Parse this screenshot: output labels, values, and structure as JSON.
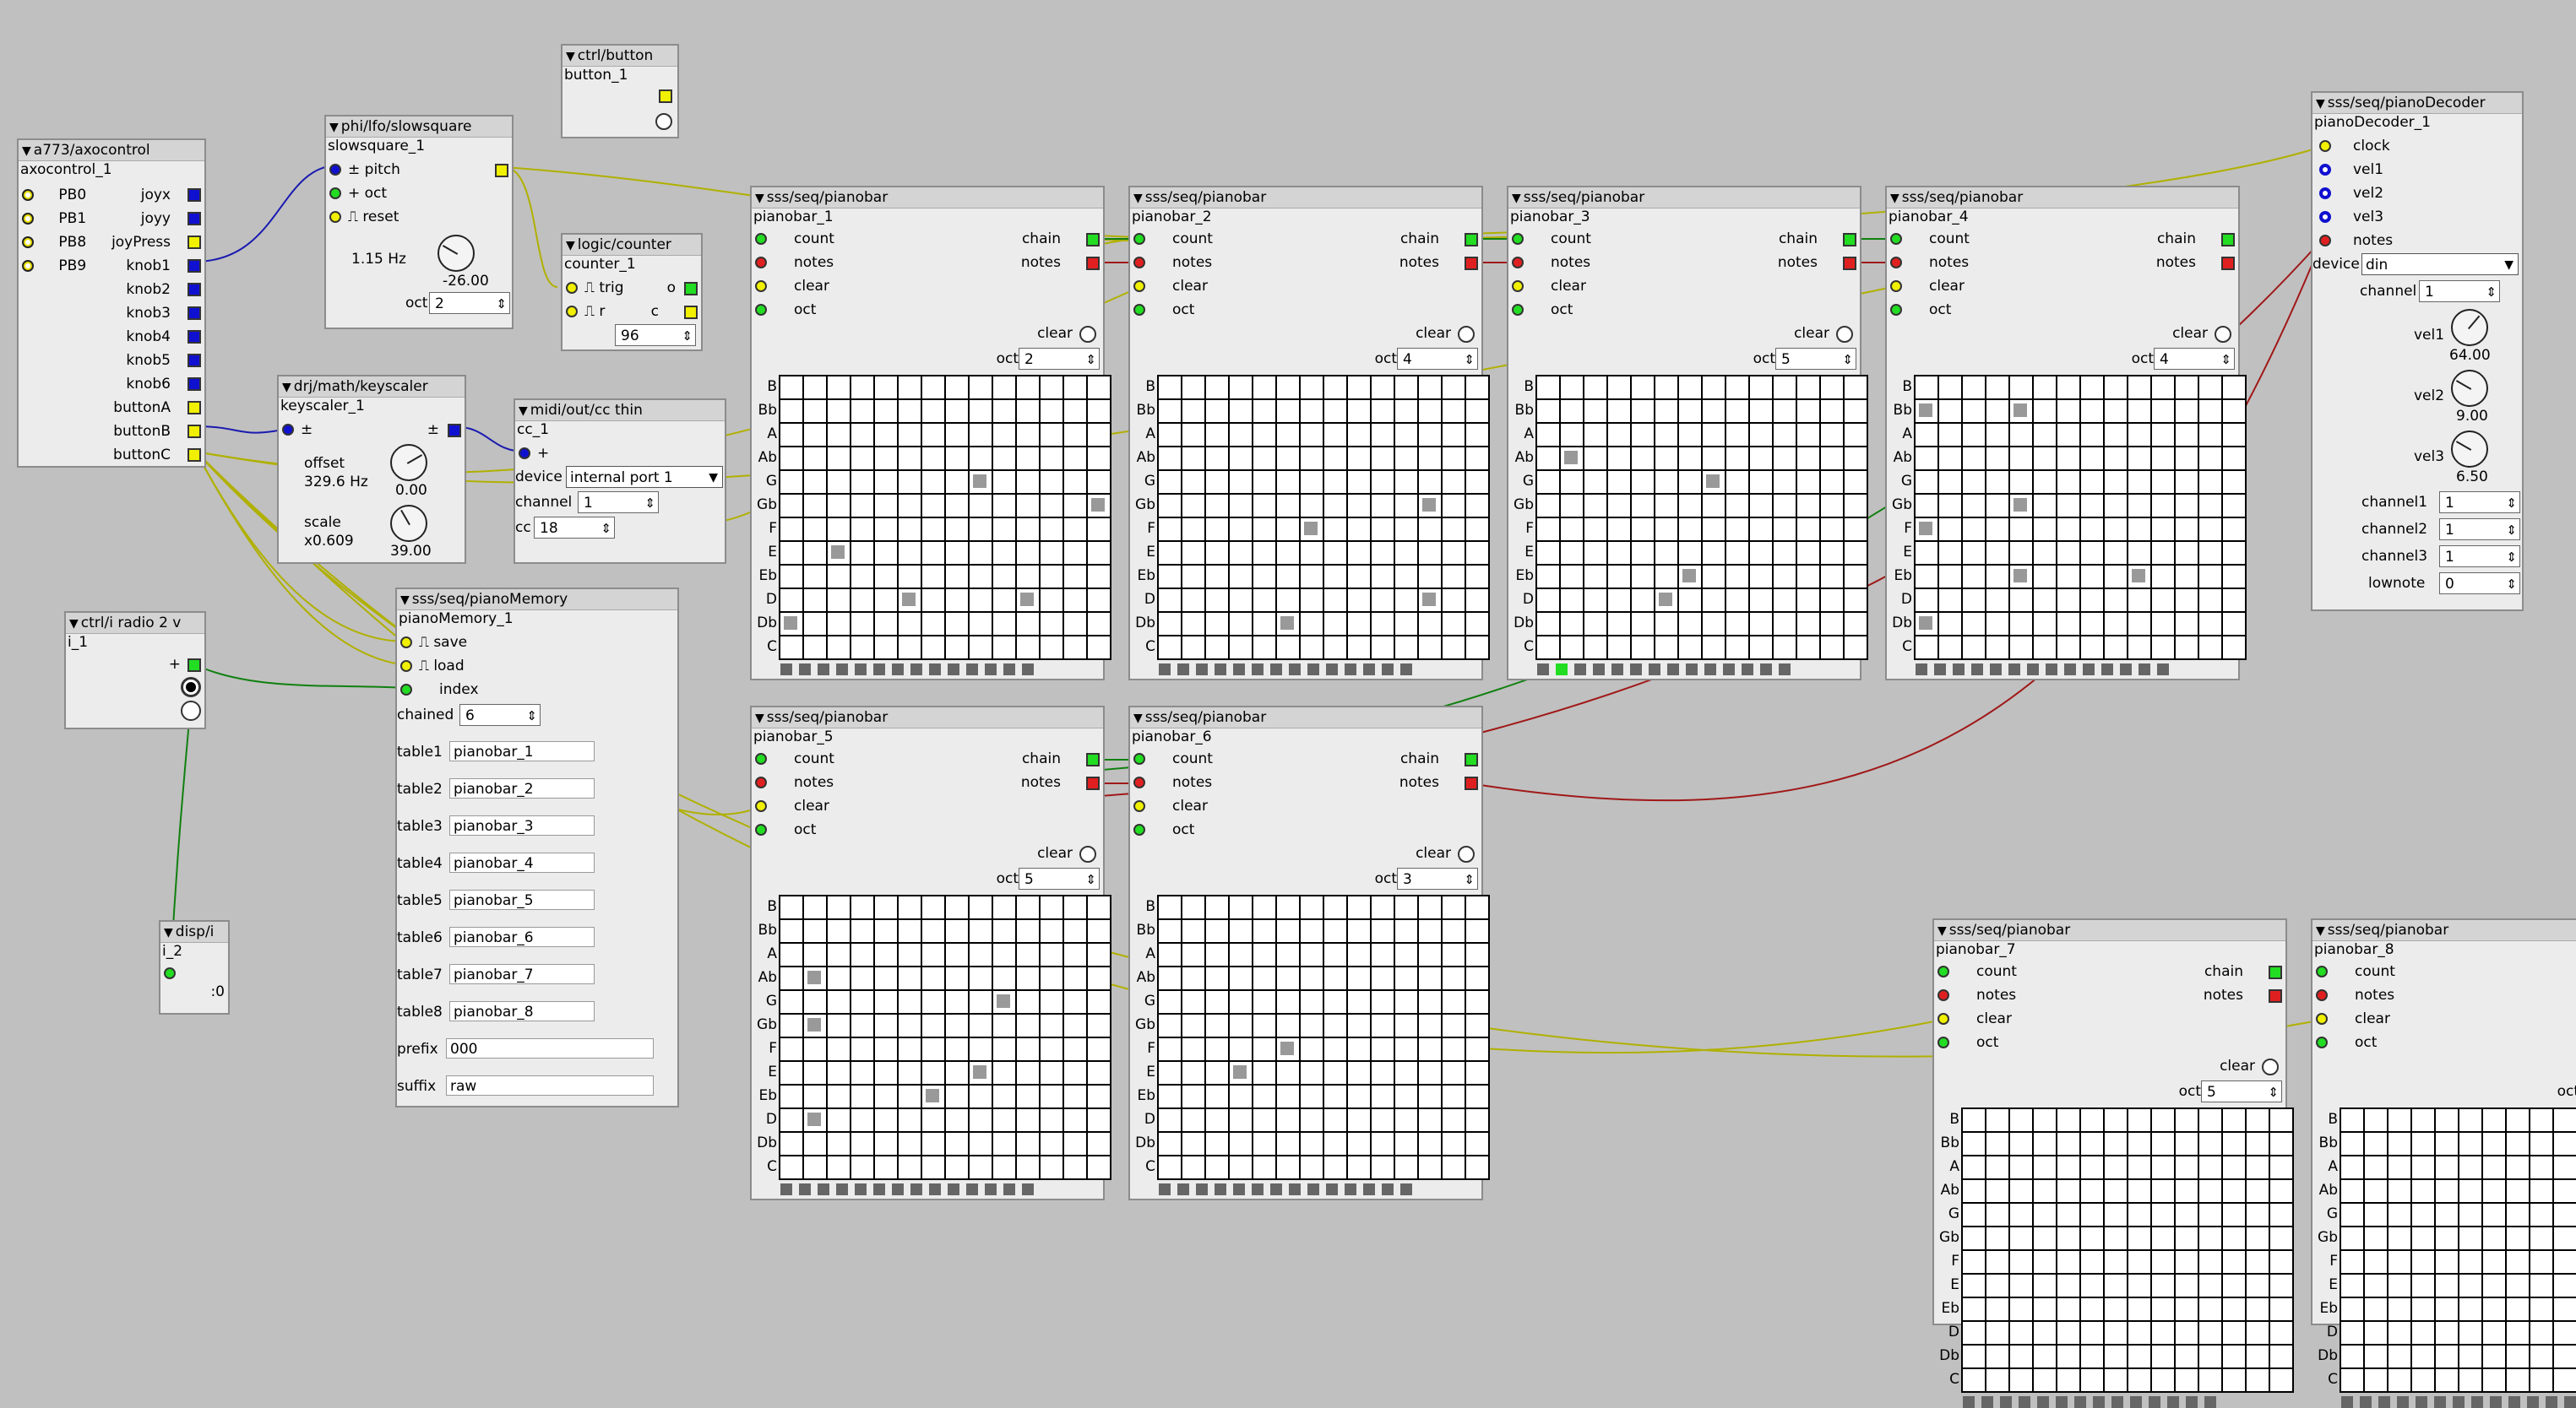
{
  "axocontrol": {
    "title": "a773/axocontrol",
    "instance": "axocontrol_1",
    "left": [
      "PB0",
      "PB1",
      "PB8",
      "PB9"
    ],
    "right": [
      "joyx",
      "joyy",
      "joyPress",
      "knob1",
      "knob2",
      "knob3",
      "knob4",
      "knob5",
      "knob6",
      "buttonA",
      "buttonB",
      "buttonC"
    ]
  },
  "slowsquare": {
    "title": "phi/lfo/slowsquare",
    "instance": "slowsquare_1",
    "pitch": "pitch",
    "oct": "oct",
    "reset": "reset",
    "freq": "1.15 Hz",
    "knob_value": "-26.00",
    "oct_label": "oct",
    "oct_value": "2"
  },
  "button": {
    "title": "ctrl/button",
    "instance": "button_1"
  },
  "counter": {
    "title": "logic/counter",
    "instance": "counter_1",
    "trig": "trig",
    "o": "o",
    "r": "r",
    "c": "c",
    "value": "96"
  },
  "keyscaler": {
    "title": "drj/math/keyscaler",
    "instance": "keyscaler_1",
    "offset": "offset",
    "offset_val": "329.6 Hz",
    "offset_knob": "0.00",
    "scale": "scale",
    "scale_val": "x0.609",
    "scale_knob": "39.00"
  },
  "ccthin": {
    "title": "midi/out/cc thin",
    "instance": "cc_1",
    "device": "device",
    "device_val": "internal port 1",
    "channel": "channel",
    "channel_val": "1",
    "cc": "cc",
    "cc_val": "18"
  },
  "radio": {
    "title": "ctrl/i radio 2 v",
    "instance": "i_1"
  },
  "dispi": {
    "title": "disp/i",
    "instance": "i_2",
    "value": ":0"
  },
  "memory": {
    "title": "sss/seq/pianoMemory",
    "instance": "pianoMemory_1",
    "save": "save",
    "load": "load",
    "index": "index",
    "chained": "chained",
    "chained_val": "6",
    "tables": [
      {
        "label": "table1",
        "value": "pianobar_1"
      },
      {
        "label": "table2",
        "value": "pianobar_2"
      },
      {
        "label": "table3",
        "value": "pianobar_3"
      },
      {
        "label": "table4",
        "value": "pianobar_4"
      },
      {
        "label": "table5",
        "value": "pianobar_5"
      },
      {
        "label": "table6",
        "value": "pianobar_6"
      },
      {
        "label": "table7",
        "value": "pianobar_7"
      },
      {
        "label": "table8",
        "value": "pianobar_8"
      }
    ],
    "prefix": "prefix",
    "prefix_val": "000",
    "suffix": "suffix",
    "suffix_val": "raw"
  },
  "decoder": {
    "title": "sss/seq/pianoDecoder",
    "instance": "pianoDecoder_1",
    "clock": "clock",
    "vel1": "vel1",
    "vel2": "vel2",
    "vel3": "vel3",
    "notes": "notes",
    "device": "device",
    "device_val": "din",
    "channel": "channel",
    "channel_val": "1",
    "vel1_val": "64.00",
    "vel2_val": "9.00",
    "vel3_val": "6.50",
    "ch1": "channel1",
    "ch1_val": "1",
    "ch2": "channel2",
    "ch2_val": "1",
    "ch3": "channel3",
    "ch3_val": "1",
    "lownote": "lownote",
    "lownote_val": "0"
  },
  "pianobar_labels": {
    "title": "sss/seq/pianobar",
    "count": "count",
    "notes": "notes",
    "clear": "clear",
    "oct": "oct",
    "chain": "chain",
    "notes_out": "notes"
  },
  "note_names": [
    "B",
    "Bb",
    "A",
    "Ab",
    "G",
    "Gb",
    "F",
    "E",
    "Eb",
    "D",
    "Db",
    "C"
  ],
  "pianobars": [
    {
      "instance": "pianobar_1",
      "oct": "2"
    },
    {
      "instance": "pianobar_2",
      "oct": "4"
    },
    {
      "instance": "pianobar_3",
      "oct": "5"
    },
    {
      "instance": "pianobar_4",
      "oct": "4"
    },
    {
      "instance": "pianobar_5",
      "oct": "5"
    },
    {
      "instance": "pianobar_6",
      "oct": "3"
    },
    {
      "instance": "pianobar_7",
      "oct": "5"
    },
    {
      "instance": "pianobar_8",
      "oct": ""
    }
  ],
  "colors": {
    "canvas": "#c0c0c0",
    "object": "#ececec",
    "header": "#d4d4d4",
    "wire_yellow": "#b0b000",
    "wire_blue": "#1a1ab0",
    "wire_green": "#108010",
    "wire_red": "#a01818"
  }
}
